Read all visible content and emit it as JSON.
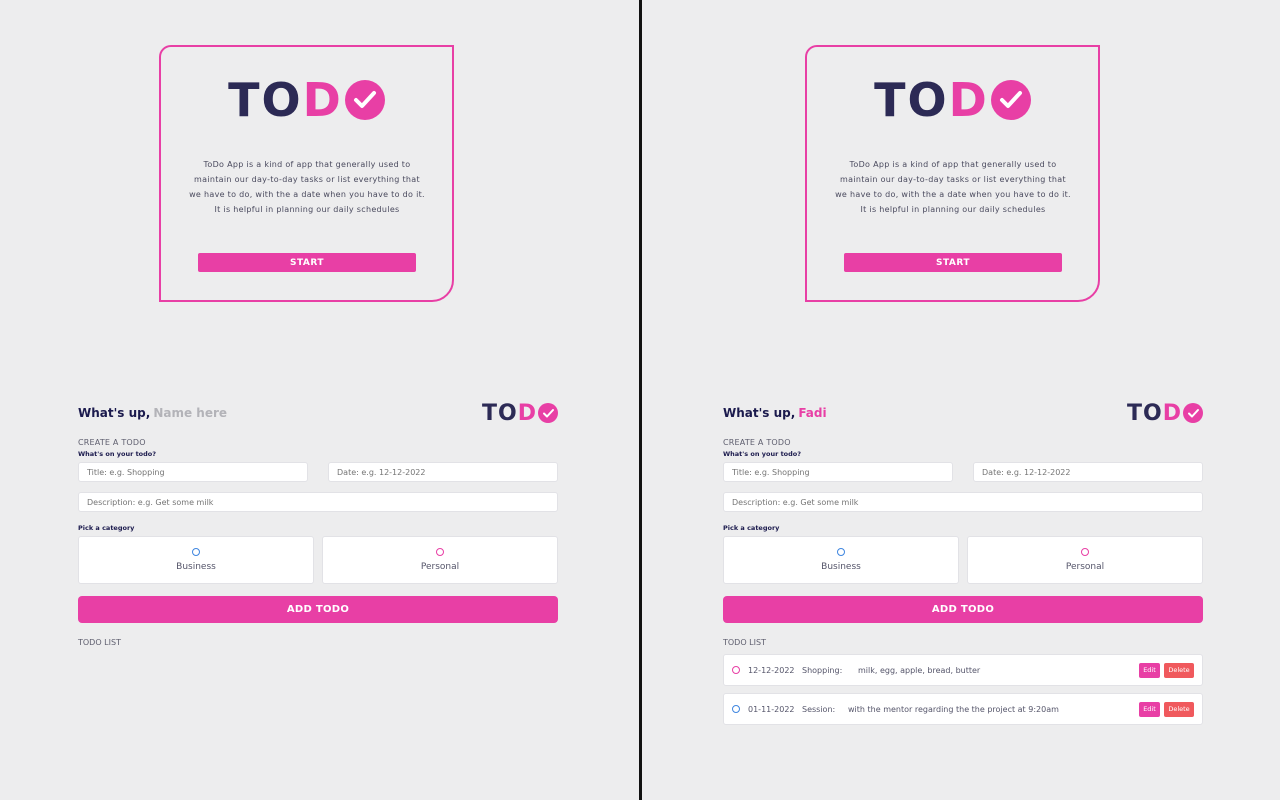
{
  "colors": {
    "accent": "#e83fa5",
    "navy": "#2c2a55",
    "business": "#3f86e0",
    "delete": "#f0595d"
  },
  "splash": {
    "logo_to": "TO",
    "logo_d": "D",
    "description": "ToDo App is a kind of app that generally used to maintain our day-to-day tasks or list everything that we have to do, with the a date when you have to do it. It is helpful in planning our daily schedules",
    "start_label": "START"
  },
  "form": {
    "greeting": "What's up,",
    "logo_to": "TO",
    "logo_d": "D",
    "create_title": "CREATE A TODO",
    "whats_on_label": "What's on your todo?",
    "title_placeholder": "Title: e.g. Shopping",
    "date_placeholder": "Date: e.g. 12-12-2022",
    "description_placeholder": "Description: e.g. Get some milk",
    "pick_category_label": "Pick a category",
    "category_business": "Business",
    "category_personal": "Personal",
    "add_label": "ADD TODO",
    "list_title": "TODO LIST",
    "edit_label": "Edit",
    "delete_label": "Delete"
  },
  "left_panel": {
    "name": "Name here"
  },
  "right_panel": {
    "name": "Fadi",
    "todos": [
      {
        "date": "12-12-2022",
        "title": "Shopping:",
        "content": "milk, egg, apple, bread, butter",
        "category": "personal"
      },
      {
        "date": "01-11-2022",
        "title": "Session:",
        "content": "with the mentor regarding the the project at 9:20am",
        "category": "business"
      }
    ]
  }
}
